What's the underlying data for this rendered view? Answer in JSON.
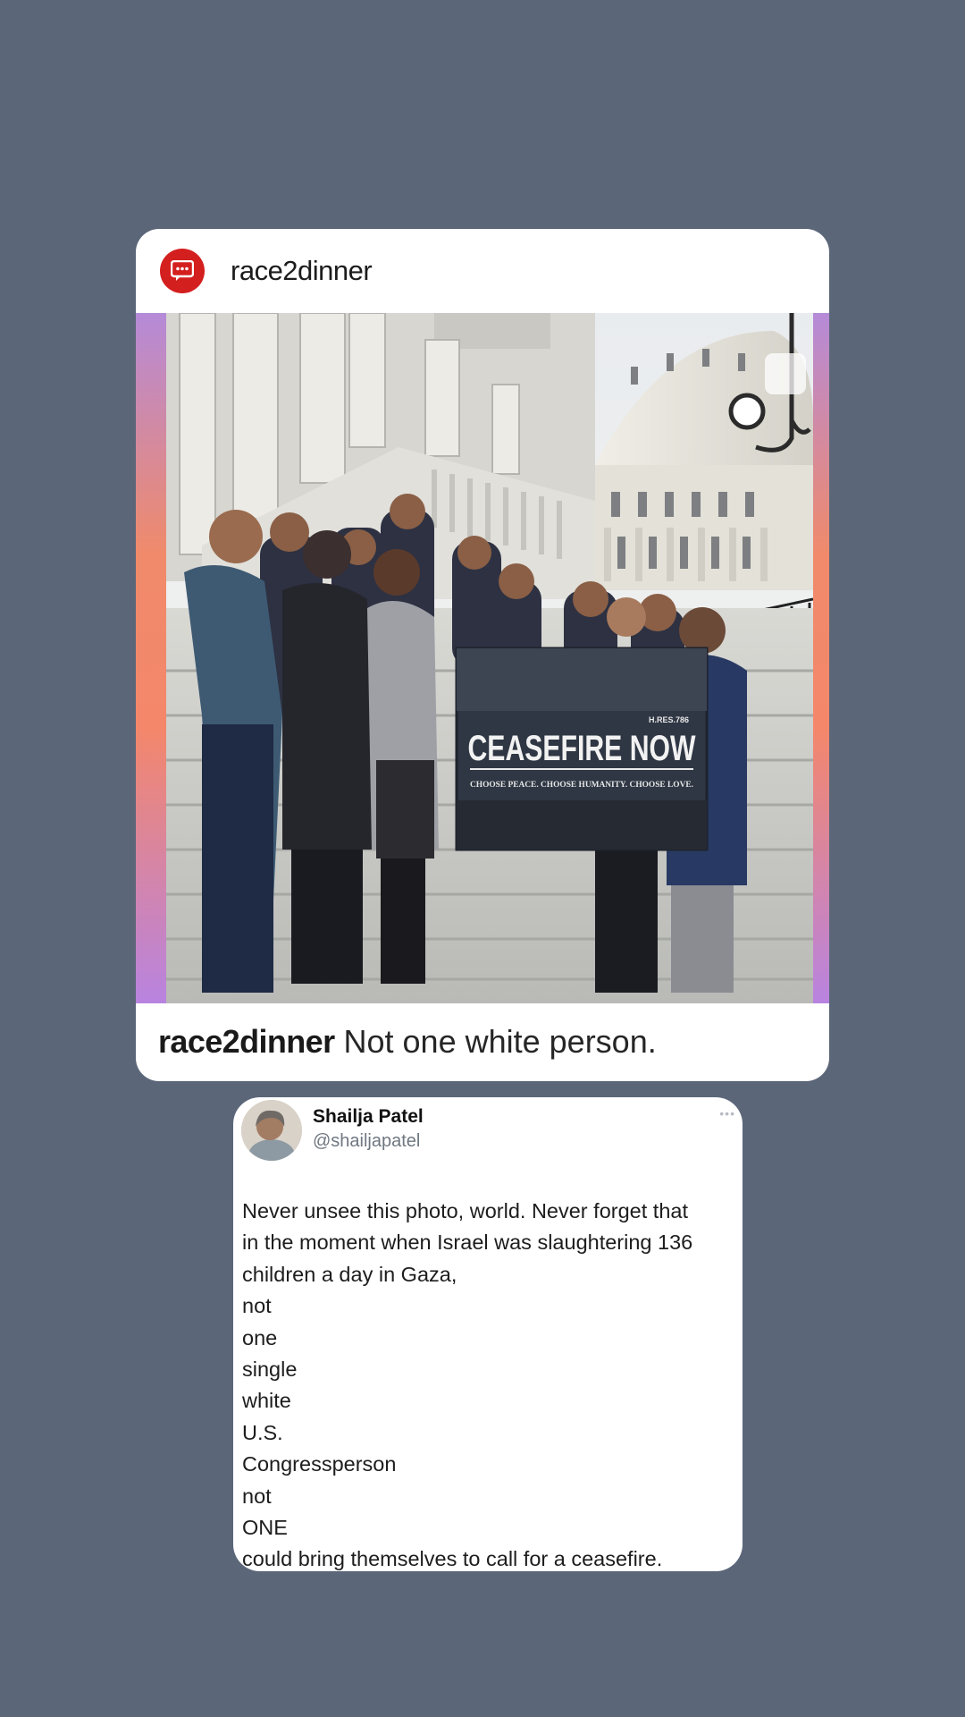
{
  "post": {
    "username": "race2dinner",
    "avatar_icon": "chat-bubble-icon",
    "photo": {
      "sign_headline": "CEASEFIRE NOW",
      "sign_tagline": "CHOOSE PEACE. CHOOSE HUMANITY. CHOOSE LOVE.",
      "sign_ref": "H.RES.786"
    },
    "caption": {
      "username": "race2dinner",
      "text": "Not one white person."
    }
  },
  "tweet": {
    "name": "Shailja Patel",
    "handle": "@shailjapatel",
    "more_icon": "more-dots-icon",
    "lines": [
      "Never unsee this photo, world. Never forget that",
      "in the moment when Israel was slaughtering 136",
      "children a day in Gaza,",
      "not",
      "one",
      "single",
      "white",
      "U.S.",
      "Congressperson",
      "not",
      "ONE",
      "could bring themselves to call for a ceasefire."
    ]
  },
  "colors": {
    "background": "#5b6679",
    "card": "#ffffff",
    "avatar_red": "#d41f1f",
    "sign_bg": "#2f3744"
  }
}
